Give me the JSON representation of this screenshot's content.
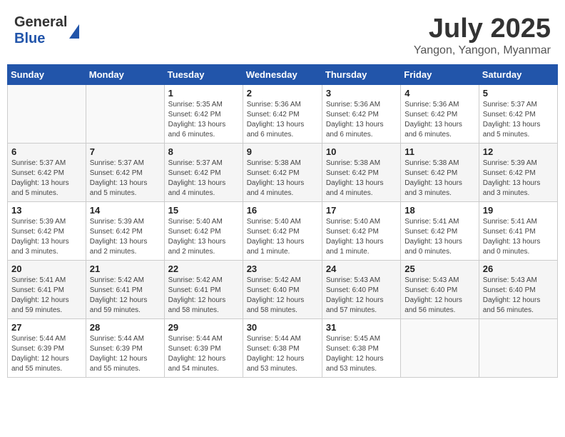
{
  "header": {
    "logo_general": "General",
    "logo_blue": "Blue",
    "month_title": "July 2025",
    "location": "Yangon, Yangon, Myanmar"
  },
  "days_of_week": [
    "Sunday",
    "Monday",
    "Tuesday",
    "Wednesday",
    "Thursday",
    "Friday",
    "Saturday"
  ],
  "weeks": [
    [
      {
        "day": "",
        "info": ""
      },
      {
        "day": "",
        "info": ""
      },
      {
        "day": "1",
        "info": "Sunrise: 5:35 AM\nSunset: 6:42 PM\nDaylight: 13 hours\nand 6 minutes."
      },
      {
        "day": "2",
        "info": "Sunrise: 5:36 AM\nSunset: 6:42 PM\nDaylight: 13 hours\nand 6 minutes."
      },
      {
        "day": "3",
        "info": "Sunrise: 5:36 AM\nSunset: 6:42 PM\nDaylight: 13 hours\nand 6 minutes."
      },
      {
        "day": "4",
        "info": "Sunrise: 5:36 AM\nSunset: 6:42 PM\nDaylight: 13 hours\nand 6 minutes."
      },
      {
        "day": "5",
        "info": "Sunrise: 5:37 AM\nSunset: 6:42 PM\nDaylight: 13 hours\nand 5 minutes."
      }
    ],
    [
      {
        "day": "6",
        "info": "Sunrise: 5:37 AM\nSunset: 6:42 PM\nDaylight: 13 hours\nand 5 minutes."
      },
      {
        "day": "7",
        "info": "Sunrise: 5:37 AM\nSunset: 6:42 PM\nDaylight: 13 hours\nand 5 minutes."
      },
      {
        "day": "8",
        "info": "Sunrise: 5:37 AM\nSunset: 6:42 PM\nDaylight: 13 hours\nand 4 minutes."
      },
      {
        "day": "9",
        "info": "Sunrise: 5:38 AM\nSunset: 6:42 PM\nDaylight: 13 hours\nand 4 minutes."
      },
      {
        "day": "10",
        "info": "Sunrise: 5:38 AM\nSunset: 6:42 PM\nDaylight: 13 hours\nand 4 minutes."
      },
      {
        "day": "11",
        "info": "Sunrise: 5:38 AM\nSunset: 6:42 PM\nDaylight: 13 hours\nand 3 minutes."
      },
      {
        "day": "12",
        "info": "Sunrise: 5:39 AM\nSunset: 6:42 PM\nDaylight: 13 hours\nand 3 minutes."
      }
    ],
    [
      {
        "day": "13",
        "info": "Sunrise: 5:39 AM\nSunset: 6:42 PM\nDaylight: 13 hours\nand 3 minutes."
      },
      {
        "day": "14",
        "info": "Sunrise: 5:39 AM\nSunset: 6:42 PM\nDaylight: 13 hours\nand 2 minutes."
      },
      {
        "day": "15",
        "info": "Sunrise: 5:40 AM\nSunset: 6:42 PM\nDaylight: 13 hours\nand 2 minutes."
      },
      {
        "day": "16",
        "info": "Sunrise: 5:40 AM\nSunset: 6:42 PM\nDaylight: 13 hours\nand 1 minute."
      },
      {
        "day": "17",
        "info": "Sunrise: 5:40 AM\nSunset: 6:42 PM\nDaylight: 13 hours\nand 1 minute."
      },
      {
        "day": "18",
        "info": "Sunrise: 5:41 AM\nSunset: 6:42 PM\nDaylight: 13 hours\nand 0 minutes."
      },
      {
        "day": "19",
        "info": "Sunrise: 5:41 AM\nSunset: 6:41 PM\nDaylight: 13 hours\nand 0 minutes."
      }
    ],
    [
      {
        "day": "20",
        "info": "Sunrise: 5:41 AM\nSunset: 6:41 PM\nDaylight: 12 hours\nand 59 minutes."
      },
      {
        "day": "21",
        "info": "Sunrise: 5:42 AM\nSunset: 6:41 PM\nDaylight: 12 hours\nand 59 minutes."
      },
      {
        "day": "22",
        "info": "Sunrise: 5:42 AM\nSunset: 6:41 PM\nDaylight: 12 hours\nand 58 minutes."
      },
      {
        "day": "23",
        "info": "Sunrise: 5:42 AM\nSunset: 6:40 PM\nDaylight: 12 hours\nand 58 minutes."
      },
      {
        "day": "24",
        "info": "Sunrise: 5:43 AM\nSunset: 6:40 PM\nDaylight: 12 hours\nand 57 minutes."
      },
      {
        "day": "25",
        "info": "Sunrise: 5:43 AM\nSunset: 6:40 PM\nDaylight: 12 hours\nand 56 minutes."
      },
      {
        "day": "26",
        "info": "Sunrise: 5:43 AM\nSunset: 6:40 PM\nDaylight: 12 hours\nand 56 minutes."
      }
    ],
    [
      {
        "day": "27",
        "info": "Sunrise: 5:44 AM\nSunset: 6:39 PM\nDaylight: 12 hours\nand 55 minutes."
      },
      {
        "day": "28",
        "info": "Sunrise: 5:44 AM\nSunset: 6:39 PM\nDaylight: 12 hours\nand 55 minutes."
      },
      {
        "day": "29",
        "info": "Sunrise: 5:44 AM\nSunset: 6:39 PM\nDaylight: 12 hours\nand 54 minutes."
      },
      {
        "day": "30",
        "info": "Sunrise: 5:44 AM\nSunset: 6:38 PM\nDaylight: 12 hours\nand 53 minutes."
      },
      {
        "day": "31",
        "info": "Sunrise: 5:45 AM\nSunset: 6:38 PM\nDaylight: 12 hours\nand 53 minutes."
      },
      {
        "day": "",
        "info": ""
      },
      {
        "day": "",
        "info": ""
      }
    ]
  ]
}
